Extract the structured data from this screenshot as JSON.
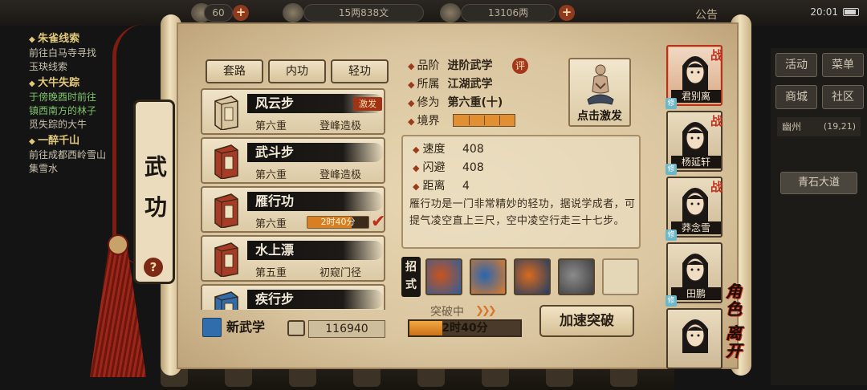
{
  "topbar": {
    "res_partial": "60",
    "coins": "15两838文",
    "silver": "13106两",
    "notice": "公告",
    "time": "20:01"
  },
  "quests": [
    {
      "title": "朱雀线索",
      "lines": [
        {
          "text": "前往白马寺寻找",
          "color": "normal"
        },
        {
          "text": "玉玦线索",
          "color": "normal"
        }
      ]
    },
    {
      "title": "大牛失踪",
      "lines": [
        {
          "text": "于傍晚酉时前往",
          "color": "green"
        },
        {
          "text": "镇西南方的林子",
          "color": "green"
        },
        {
          "text": "觅失踪的大牛",
          "color": "normal"
        }
      ]
    },
    {
      "title": "一醉千山",
      "lines": [
        {
          "text": "前往成都西岭雪山",
          "color": "normal"
        },
        {
          "text": "集雪水",
          "color": "normal"
        }
      ]
    }
  ],
  "right_menu": {
    "buttons": [
      "活动",
      "菜单",
      "商城",
      "社区"
    ],
    "location": "幽州",
    "coords": "(19,21)",
    "road": "青石大道"
  },
  "panel": {
    "side_title": "武功",
    "help": "?",
    "tabs": [
      "套路",
      "内功",
      "轻功"
    ],
    "active_tab": 2
  },
  "skills": [
    {
      "name": "风云步",
      "level": "第六重",
      "realm": "登峰造极",
      "badge": "激发",
      "book_color": "#d8c6a0"
    },
    {
      "name": "武斗步",
      "level": "第六重",
      "realm": "登峰造极",
      "book_color": "#a83b25"
    },
    {
      "name": "雁行功",
      "level": "第六重",
      "timer": "2时40分",
      "timer_progress": 0.72,
      "selected": true,
      "book_color": "#a83b25"
    },
    {
      "name": "水上漂",
      "level": "第五重",
      "realm": "初窥门径",
      "book_color": "#a83b25"
    },
    {
      "name": "疾行步",
      "level": "",
      "realm": "",
      "book_color": "#2f6dad"
    }
  ],
  "footer": {
    "new_skill": "新武学",
    "points": "116940"
  },
  "detail": {
    "attrs": [
      {
        "key": "品阶",
        "value": "进阶武学"
      },
      {
        "key": "所属",
        "value": "江湖武学"
      },
      {
        "key": "修为",
        "value": "第六重(十)"
      },
      {
        "key": "境界",
        "value": ""
      }
    ],
    "rating_badge": "评",
    "realm_segments": 4,
    "activate_label": "点击激发",
    "stats": [
      {
        "key": "速度",
        "value": "408"
      },
      {
        "key": "闪避",
        "value": "408"
      },
      {
        "key": "距离",
        "value": "4"
      }
    ],
    "description": "雁行功是一门非常精妙的轻功，据说学成者，可提气凌空直上三尺，空中凌空行走三十七步。",
    "moves_label": "招式",
    "moves": [
      {
        "icon": "move-flame-kick-icon",
        "colors": [
          "#c9531d",
          "#2f5e9b"
        ]
      },
      {
        "icon": "move-storm-dash-icon",
        "colors": [
          "#2966b0",
          "#e07b26"
        ]
      },
      {
        "icon": "move-leap-strike-icon",
        "colors": [
          "#d86a1e",
          "#1f3d66"
        ]
      },
      {
        "icon": "move-shadow-step-icon",
        "colors": [
          "#8b8b8b",
          "#3c3c3c"
        ]
      }
    ],
    "breakthrough_label": "突破中",
    "breakthrough_time": "2时40分",
    "breakthrough_progress": 0.3,
    "speedup": "加速突破"
  },
  "roster": [
    {
      "name": "君别离",
      "selected": true,
      "battle": "战",
      "xiu": "修"
    },
    {
      "name": "杨延轩",
      "selected": false,
      "battle": "战",
      "xiu": "修"
    },
    {
      "name": "莽念雪",
      "selected": false,
      "battle": "战",
      "xiu": "修"
    },
    {
      "name": "田鹏",
      "selected": false,
      "battle": "",
      "xiu": "修"
    },
    {
      "name": "",
      "selected": false,
      "battle": "",
      "xiu": ""
    }
  ],
  "side_actions": {
    "role": "角色",
    "leave": "离开"
  }
}
